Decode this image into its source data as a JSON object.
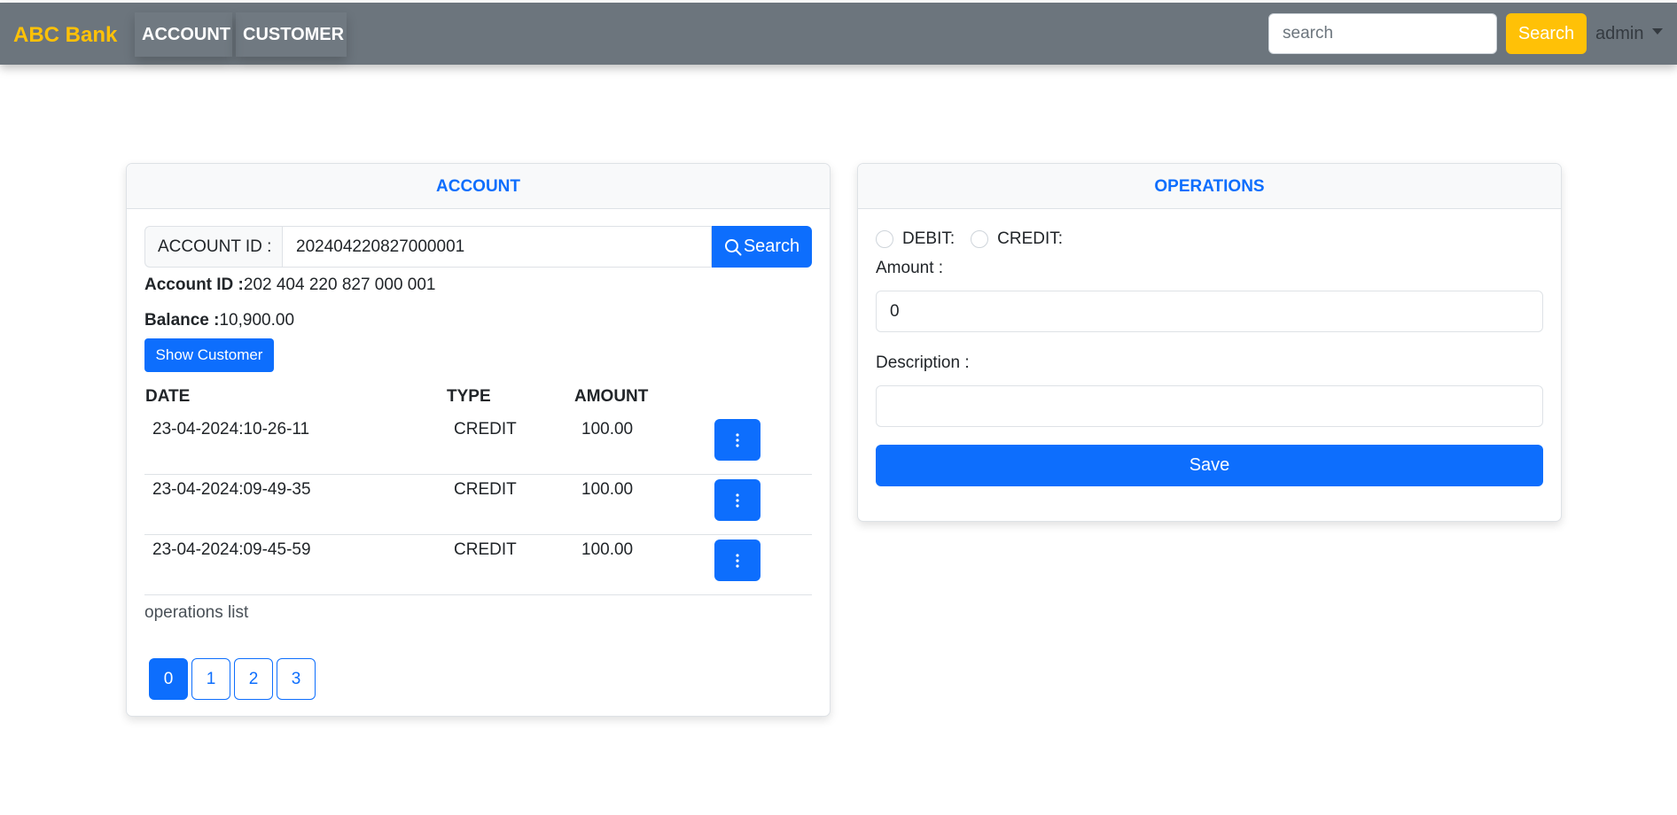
{
  "navbar": {
    "brand": "ABC Bank",
    "links": [
      "ACCOUNT",
      "CUSTOMER"
    ],
    "search_placeholder": "search",
    "search_button": "Search",
    "user": "admin"
  },
  "account_card": {
    "title": "ACCOUNT",
    "account_id_label": "ACCOUNT ID :",
    "account_id_value": "202404220827000001",
    "search_button": "Search",
    "account_id_info_label": "Account ID :",
    "account_id_info_value": "202 404 220 827 000 001",
    "balance_label": "Balance :",
    "balance_value": "10,900.00",
    "show_customer": "Show Customer",
    "columns": [
      "DATE",
      "TYPE",
      "AMOUNT"
    ],
    "rows": [
      {
        "date": "23-04-2024:10-26-11",
        "type": "CREDIT",
        "amount": "100.00"
      },
      {
        "date": "23-04-2024:09-49-35",
        "type": "CREDIT",
        "amount": "100.00"
      },
      {
        "date": "23-04-2024:09-45-59",
        "type": "CREDIT",
        "amount": "100.00"
      }
    ],
    "footer_text": "operations list",
    "pages": [
      "0",
      "1",
      "2",
      "3"
    ],
    "active_page": "0"
  },
  "operations_card": {
    "title": "OPERATIONS",
    "debit_label": "DEBIT:",
    "credit_label": "CREDIT:",
    "amount_label": "Amount :",
    "amount_value": "0",
    "description_label": "Description :",
    "description_value": "",
    "save_button": "Save"
  },
  "colors": {
    "navbar": "#6c757d",
    "brand": "#ffc107",
    "primary": "#0d6efd"
  },
  "icons": [
    "search-icon",
    "more-vertical-icon",
    "caret-down-icon"
  ]
}
